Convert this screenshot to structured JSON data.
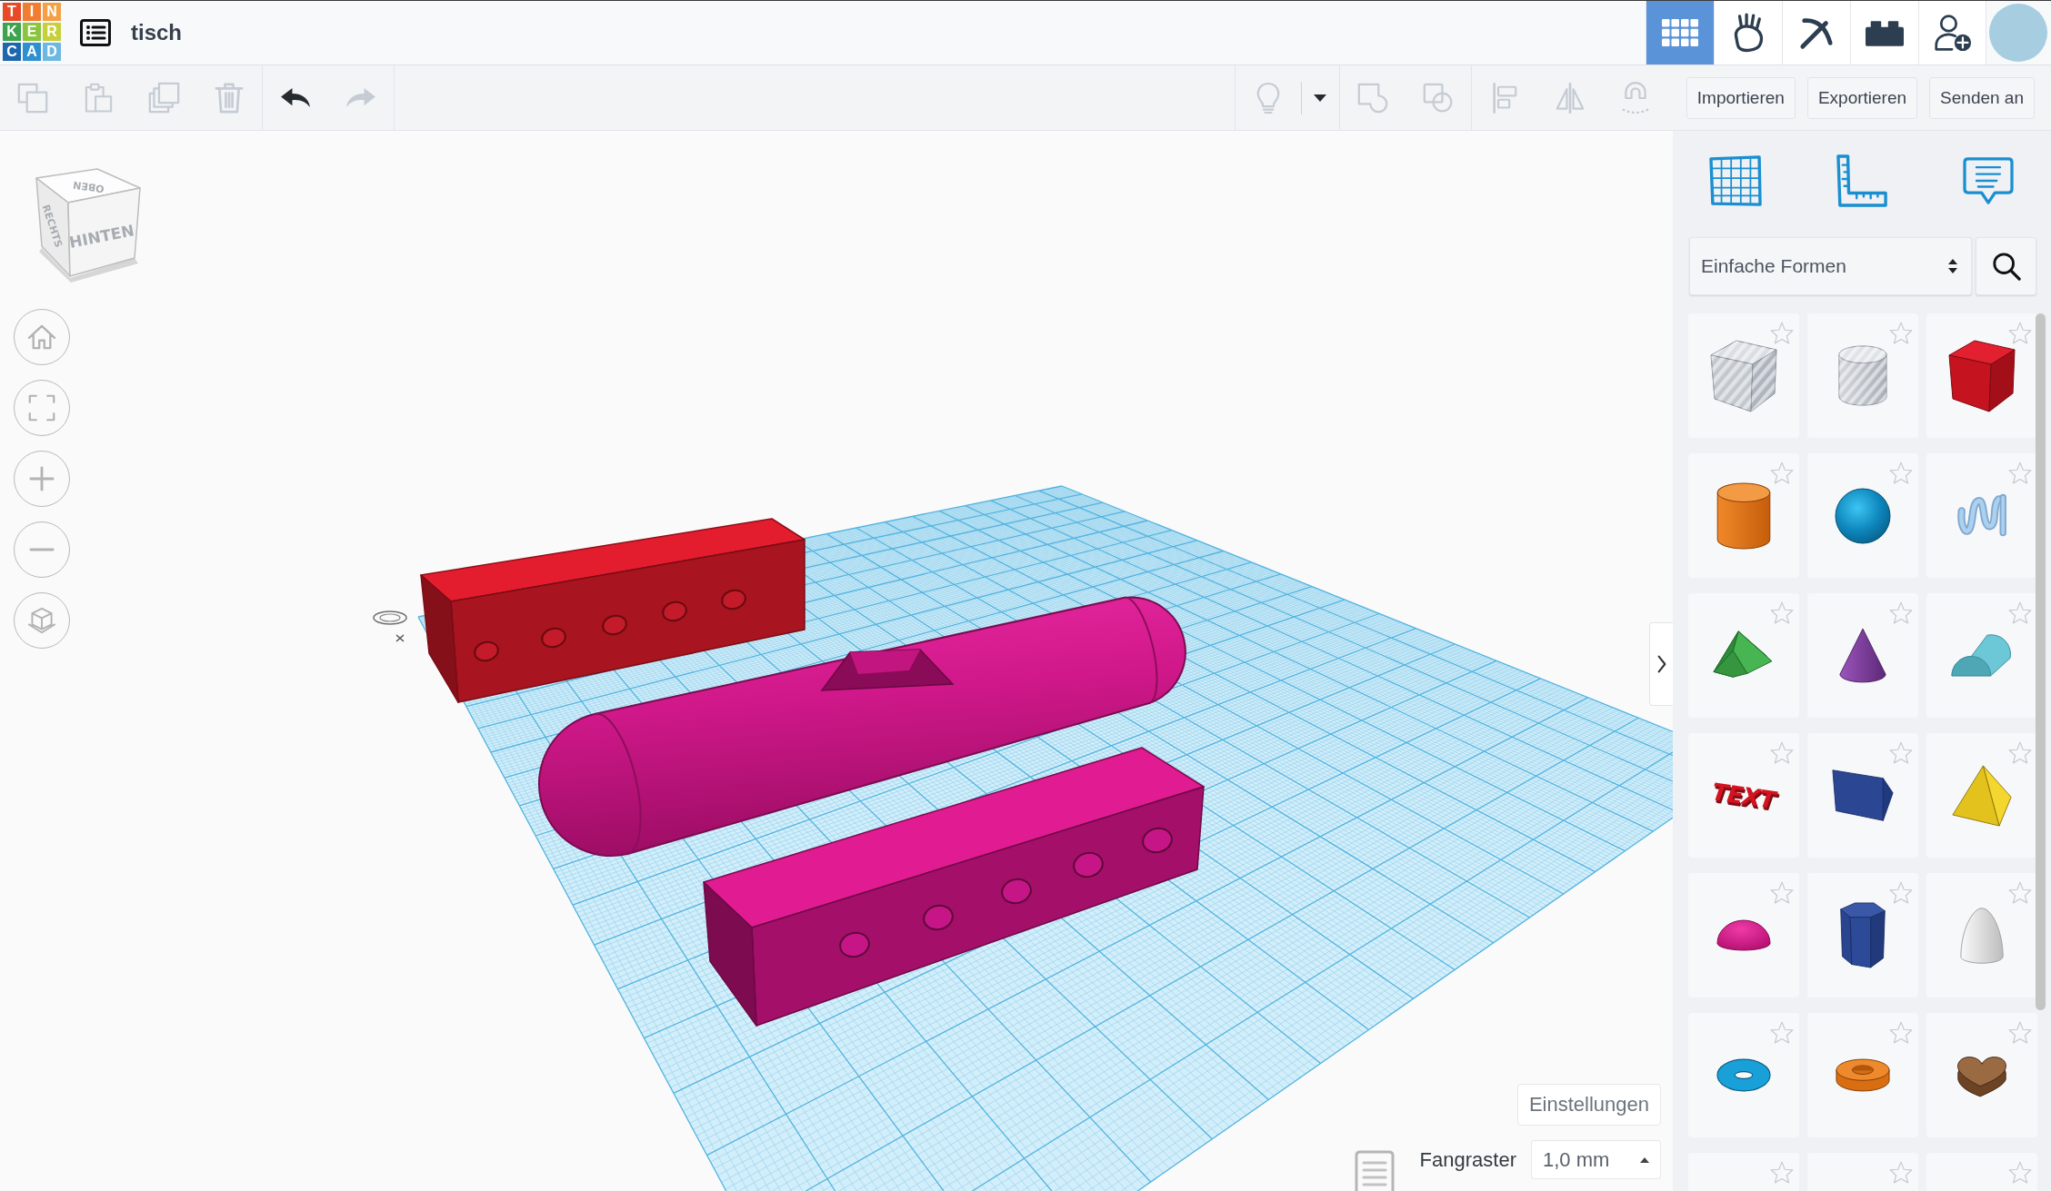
{
  "header": {
    "logo": [
      {
        "letter": "T",
        "color": "#e84a27"
      },
      {
        "letter": "I",
        "color": "#f07d31"
      },
      {
        "letter": "N",
        "color": "#f5a044"
      },
      {
        "letter": "K",
        "color": "#3da34c"
      },
      {
        "letter": "E",
        "color": "#8bc43f"
      },
      {
        "letter": "R",
        "color": "#c6d03b"
      },
      {
        "letter": "C",
        "color": "#1c67ae"
      },
      {
        "letter": "A",
        "color": "#2e8fd1"
      },
      {
        "letter": "D",
        "color": "#6cb8e3"
      }
    ],
    "title": "tisch",
    "nav_tabs": [
      {
        "kind": "grid",
        "selected": true
      },
      {
        "kind": "rock",
        "selected": false
      },
      {
        "kind": "pickaxe",
        "selected": false
      },
      {
        "kind": "brick",
        "selected": false
      }
    ]
  },
  "toolbar": {
    "left_groups": [
      {
        "tools": [
          {
            "kind": "copy",
            "disabled": true
          },
          {
            "kind": "paste",
            "disabled": true
          },
          {
            "kind": "duplicate",
            "disabled": true
          },
          {
            "kind": "delete",
            "disabled": true
          }
        ]
      },
      {
        "tools": [
          {
            "kind": "undo",
            "disabled": false
          },
          {
            "kind": "redo",
            "disabled": true
          }
        ]
      }
    ],
    "right_groups": [
      {
        "tools": [
          {
            "kind": "bulb",
            "disabled": true
          },
          {
            "kind": "caret",
            "disabled": false
          }
        ]
      },
      {
        "tools": [
          {
            "kind": "group",
            "disabled": true
          },
          {
            "kind": "ungroup",
            "disabled": true
          }
        ]
      },
      {
        "tools": [
          {
            "kind": "align",
            "disabled": true
          },
          {
            "kind": "mirror",
            "disabled": true
          },
          {
            "kind": "magnet",
            "disabled": true
          }
        ]
      }
    ],
    "buttons": [
      "Importieren",
      "Exportieren",
      "Senden an"
    ]
  },
  "viewport": {
    "view_cube": {
      "top": "OBEN",
      "side": "RECHTS",
      "front": "HINTEN"
    },
    "settings_button": "Einstellungen",
    "snap_grid": {
      "label": "Fangraster",
      "value": "1,0 mm"
    }
  },
  "panel": {
    "category": "Einfache Formen",
    "shapes": [
      {
        "kind": "boxhole",
        "starred": false
      },
      {
        "kind": "cylinderhole",
        "starred": false
      },
      {
        "kind": "box",
        "starred": false
      },
      {
        "kind": "cylinder",
        "starred": false
      },
      {
        "kind": "sphere",
        "starred": false
      },
      {
        "kind": "scribble",
        "starred": false
      },
      {
        "kind": "roof",
        "starred": false
      },
      {
        "kind": "cone",
        "starred": false
      },
      {
        "kind": "roundroof",
        "starred": false
      },
      {
        "kind": "text",
        "label": "TEXT",
        "starred": false
      },
      {
        "kind": "wedge",
        "starred": false
      },
      {
        "kind": "pyramid",
        "starred": false
      },
      {
        "kind": "halfsphere",
        "starred": false
      },
      {
        "kind": "polygon",
        "starred": false
      },
      {
        "kind": "paraboloid",
        "starred": false
      },
      {
        "kind": "torus",
        "starred": false
      },
      {
        "kind": "tube",
        "starred": false
      },
      {
        "kind": "heart",
        "starred": false
      },
      {
        "starred": false
      },
      {
        "starred": false
      },
      {
        "starred": false
      }
    ]
  }
}
